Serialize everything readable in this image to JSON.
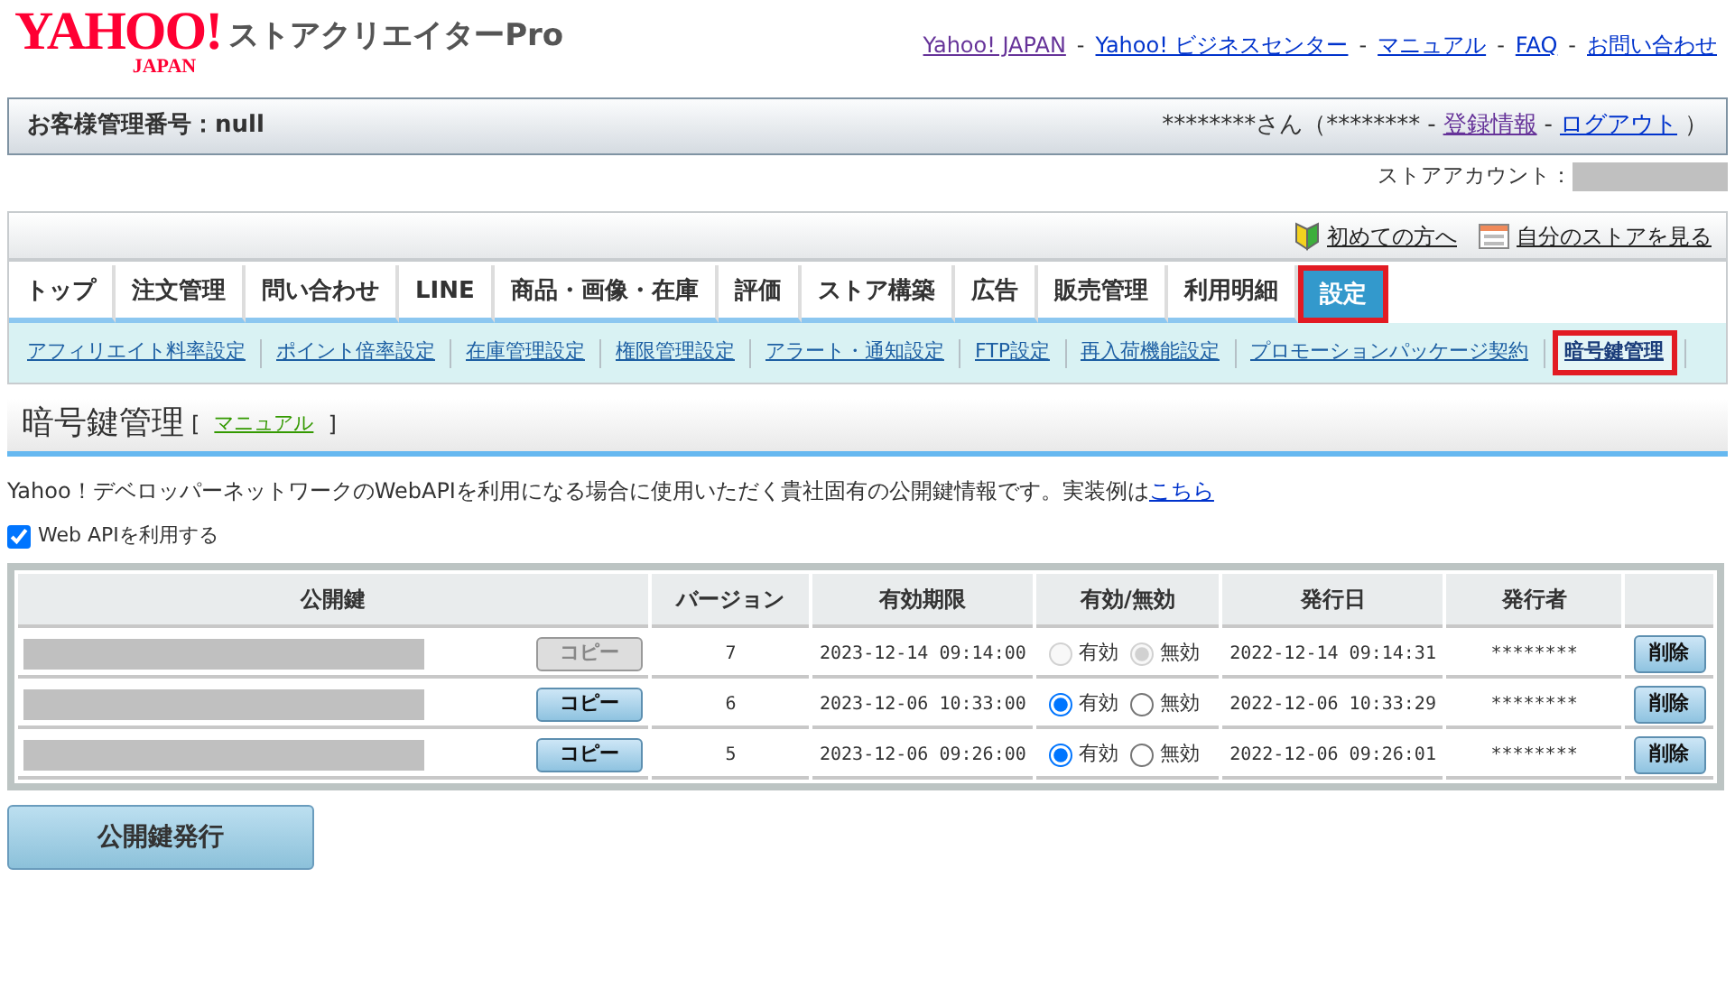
{
  "logo": {
    "brand": "YAHOO!",
    "region": "JAPAN",
    "product": "ストアクリエイターPro"
  },
  "top_links": [
    {
      "label": "Yahoo! JAPAN",
      "visited": true
    },
    {
      "label": "Yahoo! ビジネスセンター",
      "visited": false
    },
    {
      "label": "マニュアル",
      "visited": false
    },
    {
      "label": "FAQ",
      "visited": false
    },
    {
      "label": "お問い合わせ",
      "visited": false
    }
  ],
  "top_link_separator": "-",
  "customer_bar": {
    "label": "お客様管理番号：null",
    "user": "********さん（********",
    "separator": "-",
    "links": [
      {
        "label": "登録情報",
        "visited": true
      },
      {
        "label": "ログアウト",
        "visited": false
      }
    ],
    "close": "）"
  },
  "store_account": {
    "label": "ストアアカウント："
  },
  "helper_links": [
    {
      "label": "初めての方へ",
      "kind": "beginner"
    },
    {
      "label": "自分のストアを見る",
      "kind": "store"
    }
  ],
  "tabs": [
    {
      "label": "トップ",
      "selected": false
    },
    {
      "label": "注文管理",
      "selected": false
    },
    {
      "label": "問い合わせ",
      "selected": false
    },
    {
      "label": "LINE",
      "selected": false
    },
    {
      "label": "商品・画像・在庫",
      "selected": false
    },
    {
      "label": "評価",
      "selected": false
    },
    {
      "label": "ストア構築",
      "selected": false
    },
    {
      "label": "広告",
      "selected": false
    },
    {
      "label": "販売管理",
      "selected": false
    },
    {
      "label": "利用明細",
      "selected": false
    },
    {
      "label": "設定",
      "selected": true
    }
  ],
  "subnav": [
    {
      "label": "アフィリエイト料率設定",
      "selected": false
    },
    {
      "label": "ポイント倍率設定",
      "selected": false
    },
    {
      "label": "在庫管理設定",
      "selected": false
    },
    {
      "label": "権限管理設定",
      "selected": false
    },
    {
      "label": "アラート・通知設定",
      "selected": false
    },
    {
      "label": "FTP設定",
      "selected": false
    },
    {
      "label": "再入荷機能設定",
      "selected": false
    },
    {
      "label": "プロモーションパッケージ契約",
      "selected": false
    },
    {
      "label": "暗号鍵管理",
      "selected": true
    }
  ],
  "page_title": {
    "title": "暗号鍵管理",
    "open": "[",
    "link": "マニュアル",
    "close": "]"
  },
  "description": {
    "text": "Yahoo！デベロッパーネットワークのWebAPIを利用になる場合に使用いただく貴社固有の公開鍵情報です。実装例は",
    "link": "こちら"
  },
  "use_api": {
    "label": "Web APIを利用する",
    "checked": true
  },
  "table": {
    "columns": [
      "公開鍵",
      "バージョン",
      "有効期限",
      "有効/無効",
      "発行日",
      "発行者"
    ],
    "rows": [
      {
        "copy": "コピー",
        "version": "7",
        "expires": "2023-12-14 09:14:00",
        "enabled": false,
        "disabled": true,
        "on_label": "有効",
        "off_label": "無効",
        "issued": "2022-12-14 09:14:31",
        "issuer": "********",
        "delete": "削除"
      },
      {
        "copy": "コピー",
        "version": "6",
        "expires": "2023-12-06 10:33:00",
        "enabled": true,
        "disabled": false,
        "on_label": "有効",
        "off_label": "無効",
        "issued": "2022-12-06 10:33:29",
        "issuer": "********",
        "delete": "削除"
      },
      {
        "copy": "コピー",
        "version": "5",
        "expires": "2023-12-06 09:26:00",
        "enabled": true,
        "disabled": false,
        "on_label": "有効",
        "off_label": "無効",
        "issued": "2022-12-06 09:26:01",
        "issuer": "********",
        "delete": "削除"
      }
    ]
  },
  "issue_button": "公開鍵発行"
}
